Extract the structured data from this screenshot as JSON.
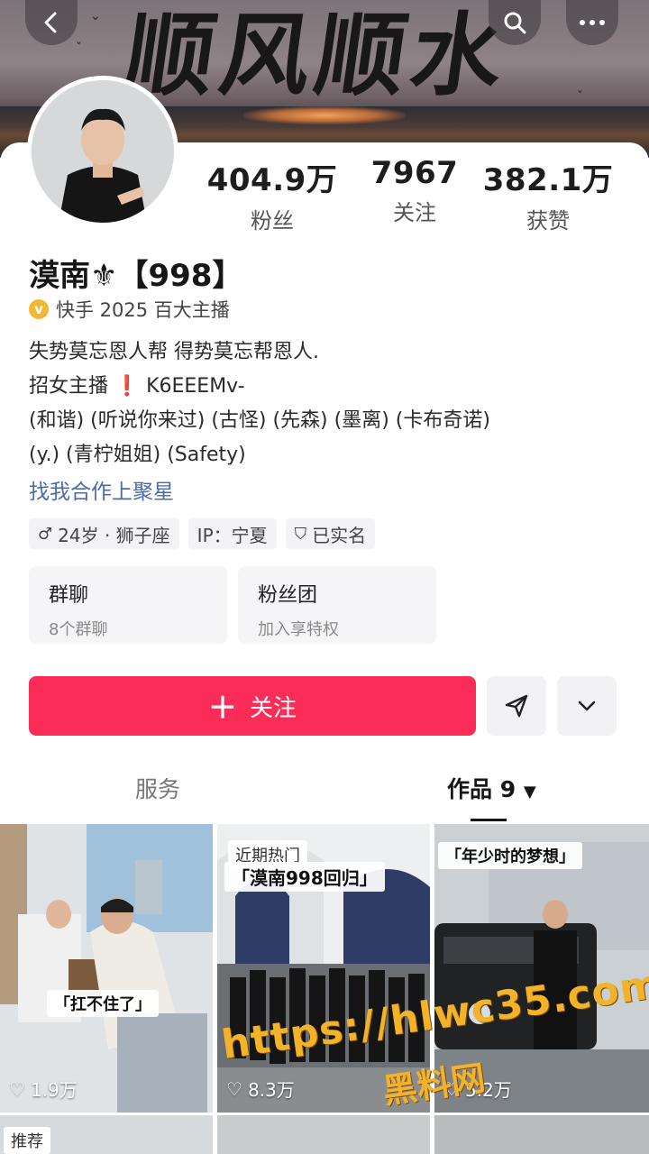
{
  "header": {
    "banner_text": "顺风顺水",
    "back_icon": "back-arrow-icon",
    "search_icon": "search-icon",
    "more_icon": "more-dots-icon"
  },
  "profile": {
    "stats": [
      {
        "value": "404.9万",
        "label": "粉丝"
      },
      {
        "value": "7967",
        "label": "关注"
      },
      {
        "value": "382.1万",
        "label": "获赞"
      }
    ],
    "name": "漠南⚜【998】",
    "verification": "快手 2025 百大主播",
    "bio_lines": [
      "失势莫忘恩人帮 得势莫忘帮恩人.",
      "招女主播",
      "K6EEEMv-",
      "(和谐) (听说你来过) (古怪) (先森) (墨离) (卡布奇诺)",
      "(y.) (青柠姐姐) (Safety)"
    ],
    "link": "找我合作上聚星",
    "tags": [
      "24岁 · 狮子座",
      "IP：宁夏",
      "已实名"
    ],
    "boxes": [
      {
        "title": "群聊",
        "subtitle": "8个群聊"
      },
      {
        "title": "粉丝团",
        "subtitle": "加入享特权"
      }
    ],
    "follow_label": "关注"
  },
  "tabs": {
    "service": "服务",
    "works": "作品 9"
  },
  "videos": [
    {
      "caption": "「扛不住了」",
      "likes": "1.9万",
      "badge": ""
    },
    {
      "caption": "「漠南998回归」",
      "likes": "8.3万",
      "badge": "近期热门"
    },
    {
      "caption": "「年少时的梦想」",
      "likes": "5.2万",
      "badge": ""
    }
  ],
  "bottom_badge": "推荐",
  "watermark": {
    "url": "https://hlwc35.com",
    "site": "黑料网"
  },
  "colors": {
    "accent": "#fb2c55",
    "link": "#4a6aa8",
    "verified": "#f1b833"
  }
}
